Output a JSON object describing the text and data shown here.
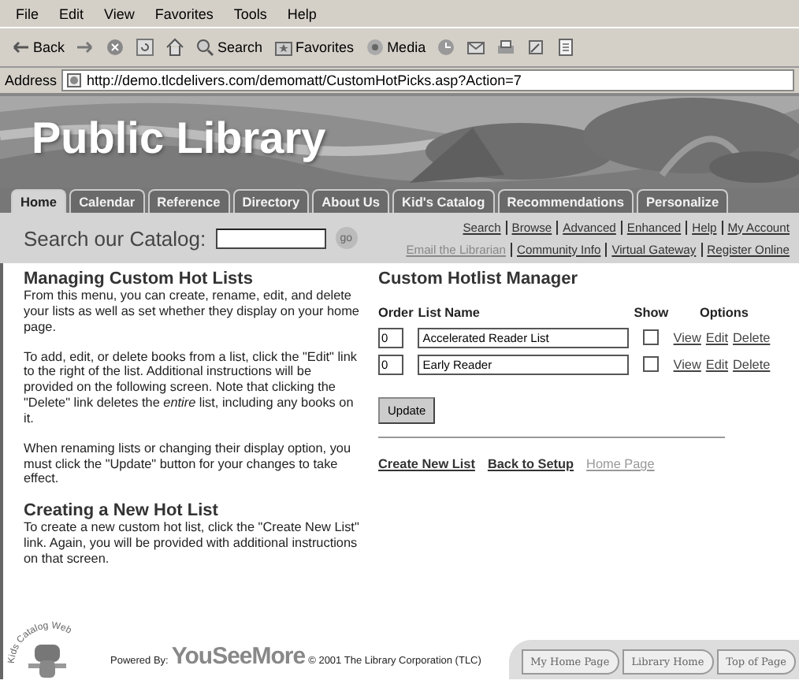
{
  "browser": {
    "menu": [
      "File",
      "Edit",
      "View",
      "Favorites",
      "Tools",
      "Help"
    ],
    "toolbar": [
      {
        "kind": "back",
        "label": "Back"
      },
      {
        "kind": "forward"
      },
      {
        "kind": "stop"
      },
      {
        "kind": "refresh"
      },
      {
        "kind": "home"
      },
      {
        "kind": "search",
        "label": "Search"
      },
      {
        "kind": "favorites",
        "label": "Favorites"
      },
      {
        "kind": "media",
        "label": "Media"
      },
      {
        "kind": "history"
      },
      {
        "kind": "mail"
      },
      {
        "kind": "print"
      },
      {
        "kind": "edit"
      },
      {
        "kind": "discuss"
      }
    ],
    "address_label": "Address",
    "url": "http://demo.tlcdelivers.com/demomatt/CustomHotPicks.asp?Action=7"
  },
  "banner": {
    "title": "Public Library"
  },
  "tabs": [
    {
      "label": "Home",
      "selected": true
    },
    {
      "label": "Calendar",
      "selected": false
    },
    {
      "label": "Reference",
      "selected": false
    },
    {
      "label": "Directory",
      "selected": false
    },
    {
      "label": "About Us",
      "selected": false
    },
    {
      "label": "Kid's Catalog",
      "selected": false
    },
    {
      "label": "Recommendations",
      "selected": false
    },
    {
      "label": "Personalize",
      "selected": false
    }
  ],
  "search": {
    "label": "Search our Catalog:",
    "button": "go",
    "links": [
      [
        {
          "label": "Search",
          "disabled": false
        },
        {
          "label": "Browse",
          "disabled": false
        },
        {
          "label": "Advanced",
          "disabled": false
        },
        {
          "label": "Enhanced",
          "disabled": false
        },
        {
          "label": "Help",
          "disabled": false
        },
        {
          "label": "My Account",
          "disabled": false
        }
      ],
      [
        {
          "label": "Email the Librarian",
          "disabled": true
        },
        {
          "label": "Community Info",
          "disabled": false
        },
        {
          "label": "Virtual Gateway",
          "disabled": false
        },
        {
          "label": "Register Online",
          "disabled": false
        }
      ]
    ]
  },
  "help": [
    {
      "heading": "Managing Custom Hot Lists",
      "paragraphs": [
        "From this menu, you can create, rename, edit, and delete your lists as well as set whether they display on your home page.",
        "To add, edit, or delete books from a list, click the \"Edit\" link to the right of the list. Additional instructions will be provided on the following screen. Note that clicking the \"Delete\" link deletes the *entire* list, including any books on it.",
        "When renaming lists or changing their display option, you must click the \"Update\" button for your changes to take effect."
      ]
    },
    {
      "heading": "Creating a New Hot List",
      "paragraphs": [
        "To create a new custom hot list, click the \"Create New List\" link. Again, you will be provided with additional instructions on that screen."
      ]
    }
  ],
  "manager": {
    "title": "Custom Hotlist Manager",
    "columns": [
      "Order",
      "List Name",
      "Show",
      "Options"
    ],
    "rows": [
      {
        "order": "0",
        "name": "Accelerated Reader List",
        "show": false,
        "actions": [
          "View",
          "Edit",
          "Delete"
        ]
      },
      {
        "order": "0",
        "name": "Early Reader",
        "show": false,
        "actions": [
          "View",
          "Edit",
          "Delete"
        ]
      }
    ],
    "update": "Update",
    "links": [
      {
        "label": "Create New List",
        "disabled": false
      },
      {
        "label": "Back to Setup",
        "disabled": false
      },
      {
        "label": "Home Page",
        "disabled": true
      }
    ]
  },
  "footer": {
    "logo_text": "Kids Catalog Web",
    "powered_by": "Powered By:",
    "brand": "YouSeeMore",
    "copyright": "© 2001 The Library Corporation (TLC)",
    "nav": [
      "My Home Page",
      "Library Home",
      "Top of Page"
    ]
  }
}
